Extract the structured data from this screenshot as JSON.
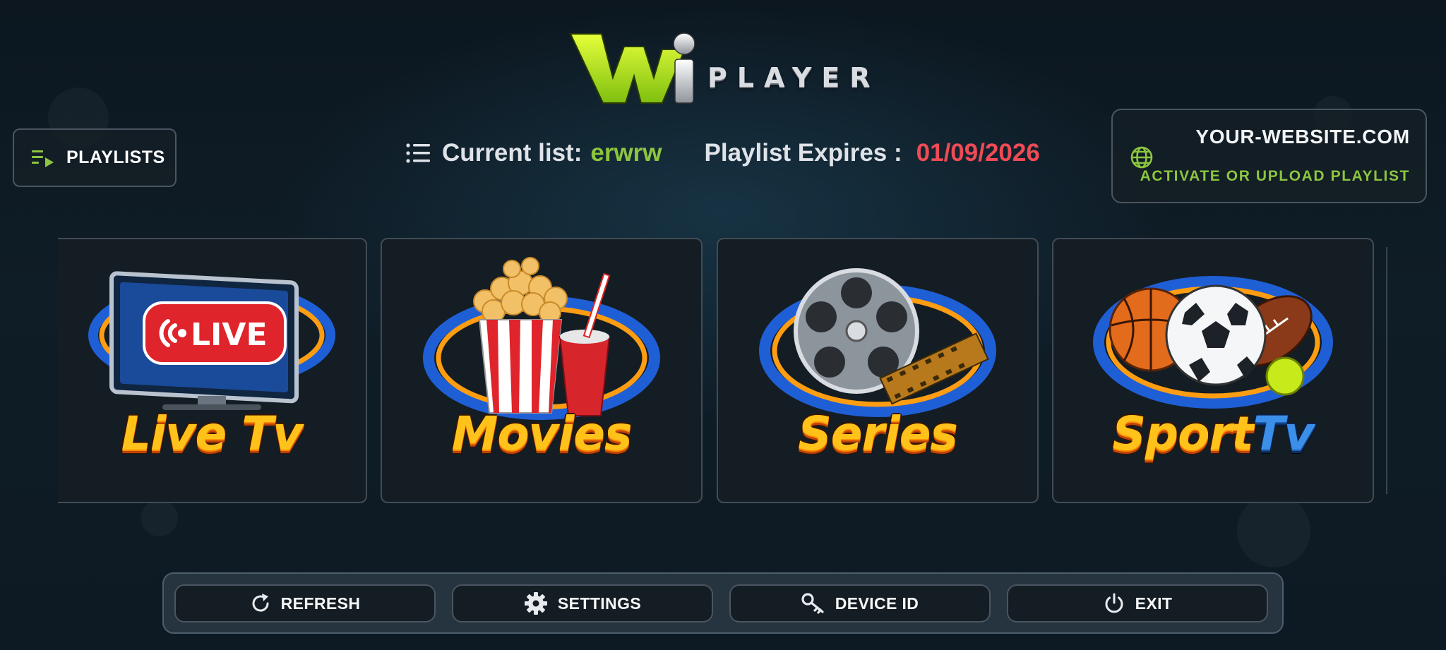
{
  "app": {
    "logo_text": "PLAYER",
    "logo_mark": "Wi",
    "accent_color": "#8cc63f",
    "expiry_color": "#ef4b55"
  },
  "header": {
    "playlists_label": "PLAYLISTS",
    "current_list_label": "Current list:",
    "current_list_value": "erwrw",
    "expires_label": "Playlist Expires :",
    "expires_value": "01/09/2026",
    "website": "YOUR-WEBSITE.COM",
    "activate_label": "ACTIVATE OR UPLOAD PLAYLIST"
  },
  "categories": [
    {
      "title_a": "Live",
      "title_b": "Tv",
      "badge": "LIVE",
      "icon": "live-tv-icon"
    },
    {
      "title_a": "Movies",
      "title_b": "",
      "icon": "popcorn-icon"
    },
    {
      "title_a": "Series",
      "title_b": "",
      "icon": "film-reel-icon"
    },
    {
      "title_a": "Sport",
      "title_b": "Tv",
      "icon": "sports-balls-icon"
    }
  ],
  "footer": {
    "refresh_label": "REFRESH",
    "settings_label": "SETTINGS",
    "device_id_label": "DEVICE ID",
    "exit_label": "EXIT"
  }
}
